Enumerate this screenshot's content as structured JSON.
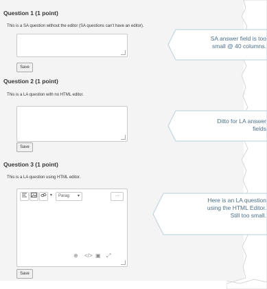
{
  "questions": [
    {
      "title": "Question 1 (1 point)",
      "text": "This is a SA question without the editor (SA questions can't have an editor).",
      "button": "Save"
    },
    {
      "title": "Question 2 (1 point)",
      "text": "This is a LA question with no HTML editor.",
      "button": "Save"
    },
    {
      "title": "Question 3 (1 point)",
      "text": "This is a LA question using HTML editor.",
      "button": "Save"
    }
  ],
  "editor_toolbar": {
    "icon_align": "align-icon",
    "icon_image": "image-icon",
    "icon_link": "link-icon",
    "paragraph_label": "Parag",
    "more": "···"
  },
  "editor_bottom_icons": [
    "spell-check-icon",
    "source-code-icon",
    "preview-icon",
    "fullscreen-icon"
  ],
  "callouts": [
    {
      "lines": [
        "SA answer field is too",
        "small @ 40 columns."
      ]
    },
    {
      "lines": [
        "Ditto for LA answer",
        "fields"
      ]
    },
    {
      "lines": [
        "Here is an LA question",
        "using the HTML Editor.",
        "Still too small."
      ]
    }
  ],
  "colors": {
    "panel": "#f4f4f4",
    "callout_text": "#4b6f8a",
    "callout_border": "#b9cfdb"
  }
}
